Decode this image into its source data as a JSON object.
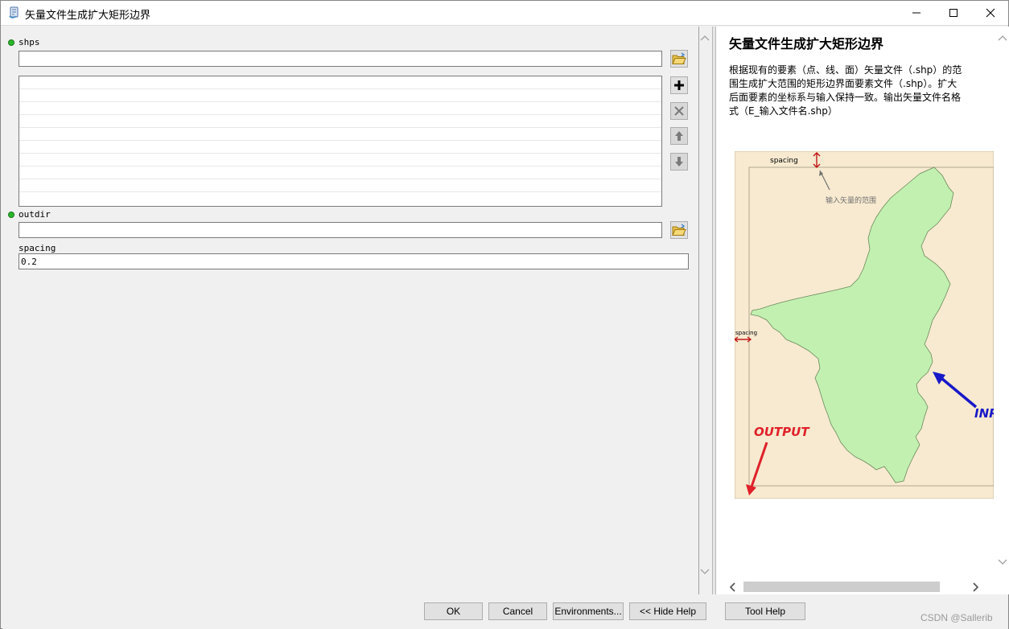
{
  "window": {
    "title": "矢量文件生成扩大矩形边界",
    "app_icon": "python-script-icon"
  },
  "params": {
    "shps_label": "shps",
    "shps_value": "",
    "outdir_label": "outdir",
    "outdir_value": "",
    "spacing_label": "spacing",
    "spacing_value": "0.2"
  },
  "help": {
    "title": "矢量文件生成扩大矩形边界",
    "desc_lines": [
      "根据现有的要素（点、线、面）矢量文件（.shp）的范",
      "围生成扩大范围的矩形边界面要素文件（.shp）。扩大",
      "后面要素的坐标系与输入保持一致。输出矢量文件名格",
      "式（E_输入文件名.shp）"
    ],
    "figure": {
      "spacing_top": "spacing",
      "spacing_left": "spacing",
      "input_note": "输入矢量的范围",
      "output_label": "OUTPUT",
      "input_label": "INPUT"
    }
  },
  "buttons": {
    "ok": "OK",
    "cancel": "Cancel",
    "environments": "Environments...",
    "hide_help": "<< Hide Help",
    "tool_help": "Tool Help"
  },
  "watermark": "CSDN @Sallerib",
  "colors": {
    "map_bg": "#f7ead0",
    "polygon_fill": "#c2f0b1",
    "output_red": "#e0202a",
    "input_blue": "#1818c8",
    "required_dot": "#2ab52a"
  }
}
